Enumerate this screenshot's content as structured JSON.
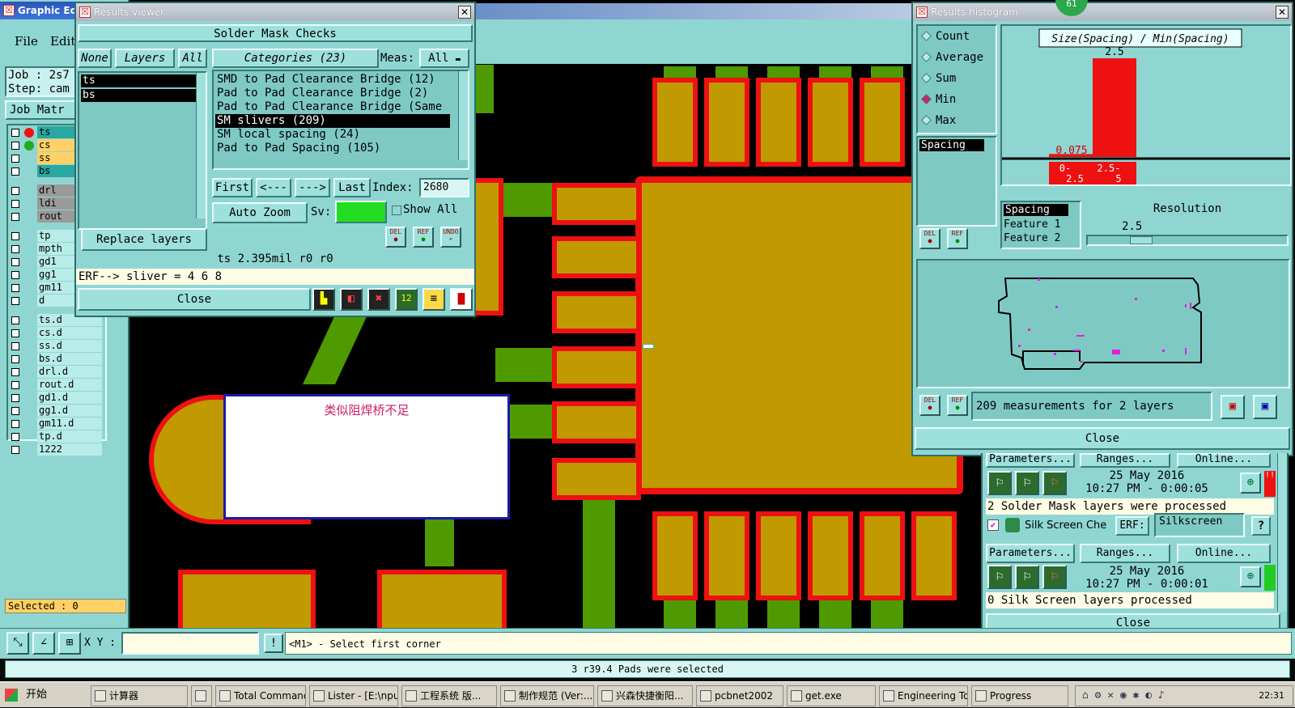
{
  "graphic_editor": {
    "title": "Graphic Edi",
    "menu": [
      "File",
      "Edit"
    ],
    "job_label": "Job : 2s7",
    "step_label": "Step: cam",
    "job_matrix_label": "Job Matr",
    "layers": [
      "ts",
      "cs",
      "ss",
      "bs",
      "drl",
      "ldi",
      "rout",
      "tp",
      "mpth",
      "gd1",
      "gg1",
      "gm11",
      "d",
      "ts.d",
      "cs.d",
      "ss.d",
      "bs.d",
      "drl.d",
      "rout.d",
      "gd1.d",
      "gg1.d",
      "gm11.d",
      "tp.d",
      "1222"
    ],
    "selected_label": "Selected : 0",
    "xy_label": "X Y :",
    "xy_value": "",
    "hint": "<M1> - Select first corner",
    "status": "3 r39.4 Pads were selected",
    "canvas_note": "类似阻焊桥不足",
    "colors": {
      "copper": "#c09a00",
      "mask": "#ee1111",
      "trace": "#4f9a00",
      "panel": "#8fd6d2"
    }
  },
  "results_viewer": {
    "title": "Results viewer",
    "header": "Solder Mask Checks",
    "none_label": "None",
    "layers_label": "Layers",
    "all_label": "All",
    "layers": [
      "ts",
      "bs"
    ],
    "categories_label": "Categories (23)",
    "meas_label": "Meas:",
    "meas_value": "All",
    "categories": [
      "SMD to Pad Clearance Bridge (12)",
      "Pad to Pad Clearance Bridge (2)",
      "Pad to Pad Clearance Bridge (Same",
      "SM slivers (209)",
      "SM local spacing (24)",
      "Pad to Pad Spacing (105)"
    ],
    "selected_category": "SM slivers (209)",
    "first_label": "First",
    "prev_label": "<---",
    "next_label": "--->",
    "last_label": "Last",
    "index_label": "Index:",
    "index_value": "2680",
    "auto_zoom_label": "Auto Zoom",
    "sv_label": "Sv:",
    "show_all_label": "Show All",
    "replace_layers_label": "Replace layers",
    "del_label": "DEL",
    "ref_label": "REF",
    "undo_label": "UNDO",
    "info_line": "ts 2.395mil  r0  r0",
    "erf_line": "ERF--> sliver = 4 6 8",
    "close_label": "Close"
  },
  "histogram": {
    "title": "Results histogram",
    "badge": "61",
    "options": [
      "Count",
      "Average",
      "Sum",
      "Min",
      "Max"
    ],
    "selected_option": "Min",
    "chart_title": "Size(Spacing) / Min(Spacing)",
    "list_item": "Spacing",
    "resolution_items": [
      "Spacing",
      "Feature 1",
      "Feature 2"
    ],
    "resolution_label": "Resolution",
    "resolution_value": "2.5",
    "summary": "209 measurements for 2 layers",
    "close_label": "Close",
    "del_label": "DEL",
    "ref_label": "REF",
    "chart_data": {
      "type": "bar",
      "title": "Size(Spacing) / Min(Spacing)",
      "categories": [
        "0-2.5",
        "2.5-5"
      ],
      "values": [
        0.075,
        2.5
      ],
      "ylim": [
        0,
        2.5
      ],
      "bar_color": "#ee1111"
    }
  },
  "checklist": {
    "parameters_label": "Parameters...",
    "ranges_label": "Ranges...",
    "online_label": "Online...",
    "run1_date": "25 May 2016",
    "run1_time": "10:27 PM - 0:00:05",
    "run1_result": "2 Solder Mask layers were processed",
    "silk_name": "Silk Screen Che",
    "erf_label": "ERF:",
    "erf_value": "Silkscreen",
    "help_label": "?",
    "run2_date": "25 May 2016",
    "run2_time": "10:27 PM - 0:00:01",
    "run2_result": "0 Silk Screen layers processed",
    "close_label": "Close"
  },
  "taskbar": {
    "start_label": "开始",
    "items": [
      "计算器",
      "",
      "Total Command...",
      "Lister - [E:\\npu...",
      "工程系统  版...",
      "制作规范 (Ver:...",
      "兴森快捷衡阳...",
      "pcbnet2002",
      "get.exe",
      "Engineering To...",
      "Progress"
    ],
    "clock": "22:31"
  }
}
